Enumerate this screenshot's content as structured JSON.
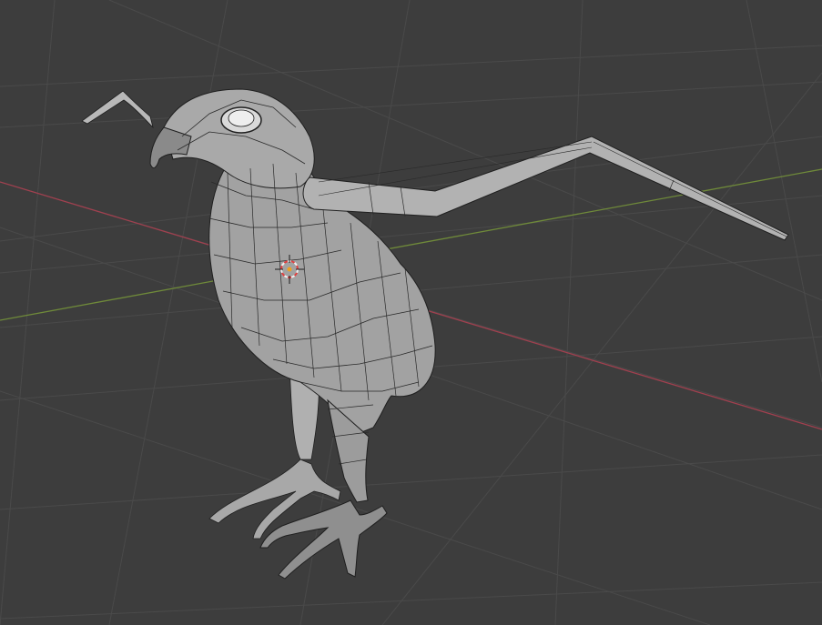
{
  "viewport": {
    "editor": "3D Viewport",
    "shading": "solid",
    "overlays": "wireframe",
    "object_subject": "bird",
    "colors": {
      "background": "#3d3d3d",
      "grid": "#4a4a4a",
      "x_axis": "#a0404f",
      "y_axis": "#6f8a3a",
      "mesh_fill": "#9a9a9a",
      "mesh_highlight": "#b5b5b5",
      "wire": "#1f1f1f",
      "cursor_red": "#e04040",
      "cursor_white": "#f0f0f0"
    }
  }
}
